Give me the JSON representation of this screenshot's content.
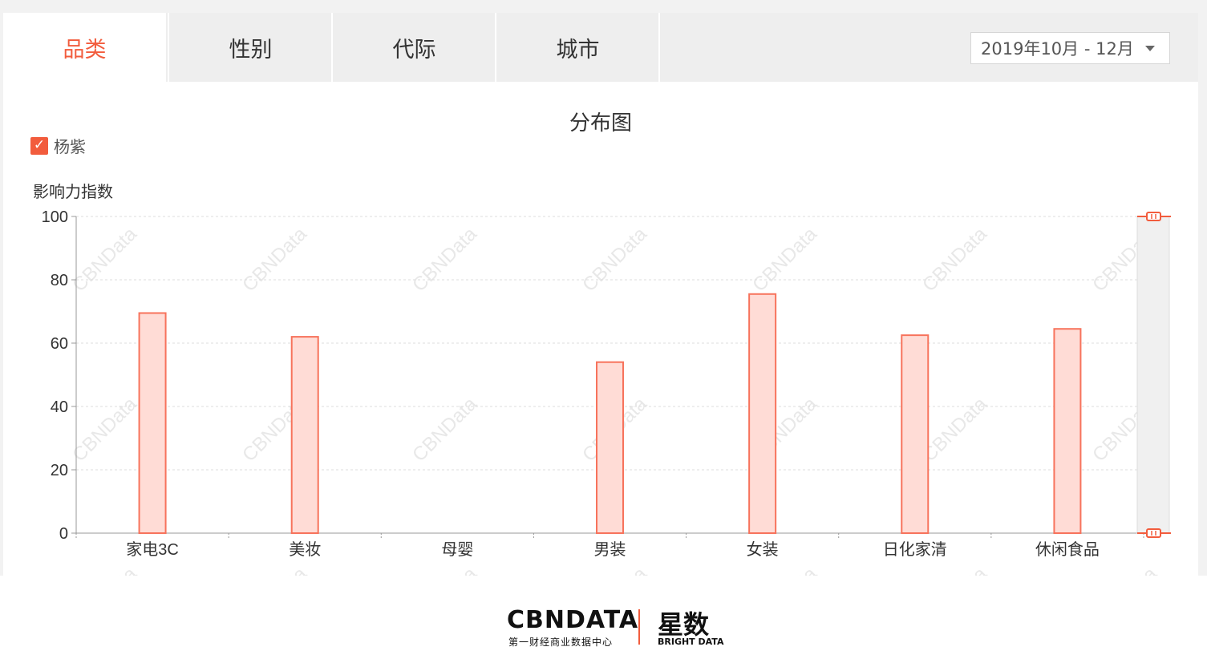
{
  "tabs": [
    {
      "label": "品类",
      "active": true
    },
    {
      "label": "性别",
      "active": false
    },
    {
      "label": "代际",
      "active": false
    },
    {
      "label": "城市",
      "active": false
    }
  ],
  "date_range": {
    "value": "2019年10月 - 12月",
    "icon": "chevron-down-icon"
  },
  "watermark": "CBNData",
  "footer": {
    "brand_main": "CBNDATA",
    "brand_sub": "第一财经商业数据中心",
    "brand2_main": "星数",
    "brand2_sub": "BRIGHT DATA"
  },
  "colors": {
    "accent": "#f25c3d",
    "bar_fill": "#ffdcd6",
    "bar_stroke": "#f7735c",
    "grid": "#dddddd",
    "axis": "#999999"
  },
  "chart_data": {
    "type": "bar",
    "title": "分布图",
    "ylabel": "影响力指数",
    "xlabel": "",
    "ylim": [
      0,
      100
    ],
    "yticks": [
      0,
      20,
      40,
      60,
      80,
      100
    ],
    "categories": [
      "家电3C",
      "美妆",
      "母婴",
      "男装",
      "女装",
      "日化家清",
      "休闲食品"
    ],
    "series": [
      {
        "name": "杨紫",
        "values": [
          69.5,
          62,
          0,
          54,
          75.5,
          62.5,
          64.5
        ]
      }
    ],
    "legend": "top-left",
    "grid": true,
    "datazoom": {
      "orientation": "vertical",
      "start": 0,
      "end": 100
    }
  }
}
